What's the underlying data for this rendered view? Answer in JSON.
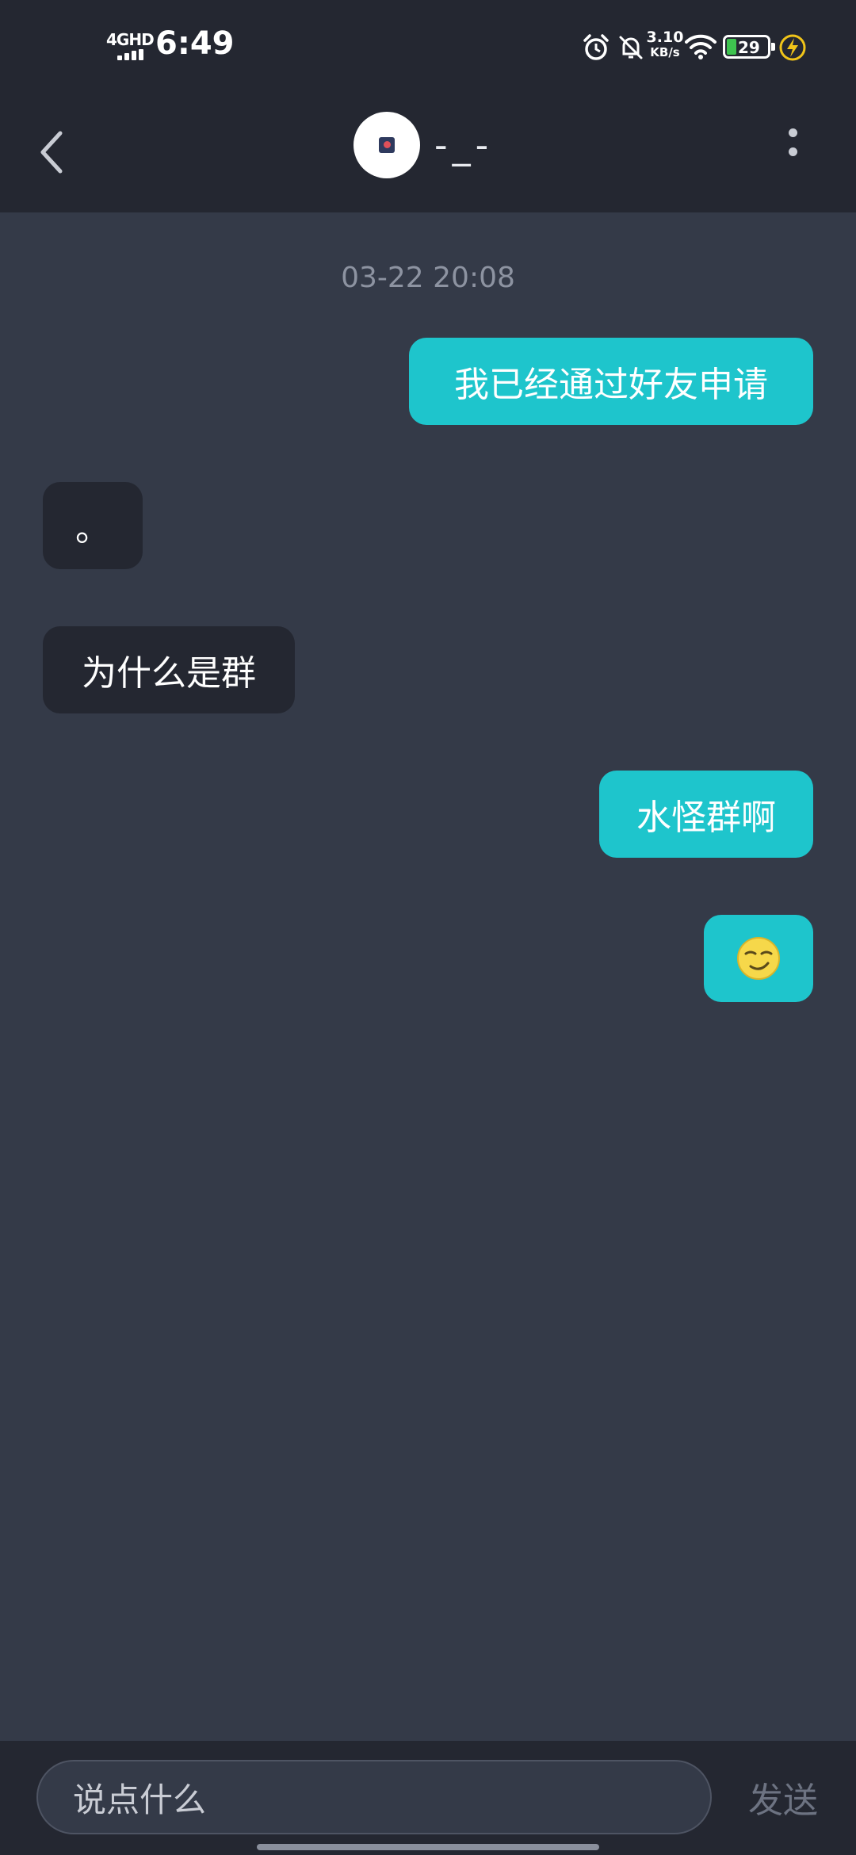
{
  "status_bar": {
    "network": "4GHD",
    "time": "6:49",
    "speed_value": "3.10",
    "speed_unit": "KB/s",
    "battery_level": "29",
    "icons": [
      "signal-icon",
      "alarm-icon",
      "mute-icon",
      "wifi-icon",
      "battery-icon",
      "charge-icon"
    ]
  },
  "header": {
    "back_icon": "chevron-left-icon",
    "contact_name": "-_-",
    "more_icon": "more-vertical-icon"
  },
  "chat": {
    "timestamp": "03-22 20:08",
    "messages": [
      {
        "direction": "outgoing",
        "text": "我已经通过好友申请"
      },
      {
        "direction": "incoming",
        "text": "。"
      },
      {
        "direction": "incoming",
        "text": "为什么是群"
      },
      {
        "direction": "outgoing",
        "text": "水怪群啊"
      },
      {
        "direction": "outgoing",
        "emoji": "smirk-emoji"
      }
    ]
  },
  "composer": {
    "placeholder": "说点什么",
    "send_label": "发送"
  },
  "colors": {
    "outgoing_bubble": "#1ec5cc",
    "incoming_bubble": "#242731",
    "background": "#343a48",
    "bar": "#242731"
  }
}
